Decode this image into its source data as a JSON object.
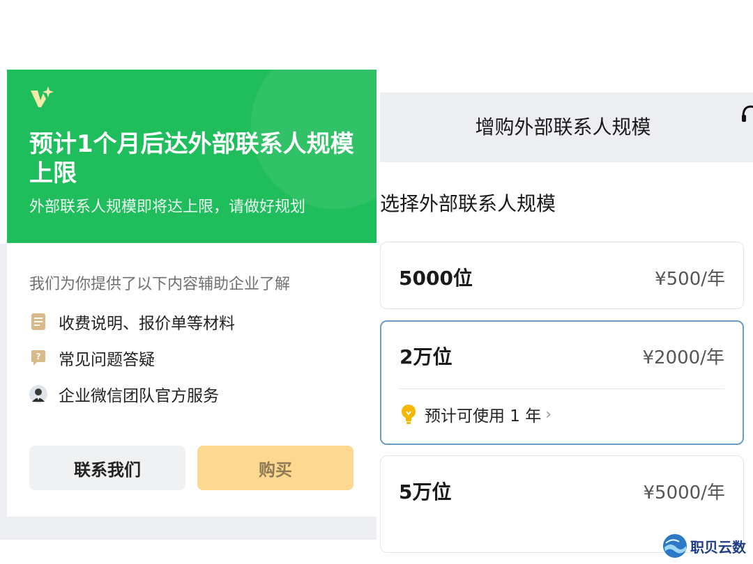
{
  "left_card": {
    "title": "预计1个月后达外部联系人规模上限",
    "subtitle": "外部联系人规模即将达上限，请做好规划",
    "intro": "我们为你提供了以下内容辅助企业了解",
    "features": [
      {
        "label": "收费说明、报价单等材料",
        "icon": "document-icon"
      },
      {
        "label": "常见问题答疑",
        "icon": "question-icon"
      },
      {
        "label": "企业微信团队官方服务",
        "icon": "avatar"
      }
    ],
    "contact_button": "联系我们",
    "buy_button": "购买"
  },
  "right_panel": {
    "nav_title": "增购外部联系人规模",
    "section_title": "选择外部联系人规模",
    "options": [
      {
        "name": "5000位",
        "price": "¥500/年"
      },
      {
        "name": "2万位",
        "price": "¥2000/年",
        "note": "预计可使用 1 年",
        "selected": true
      },
      {
        "name": "5万位",
        "price": "¥5000/年"
      }
    ]
  },
  "watermark": {
    "text": "职贝云数"
  },
  "colors": {
    "brand_green": "#20bd5c",
    "buy_button": "#fcd890",
    "selected_border": "#6b9bc9",
    "nav_bg": "#eceef1"
  }
}
